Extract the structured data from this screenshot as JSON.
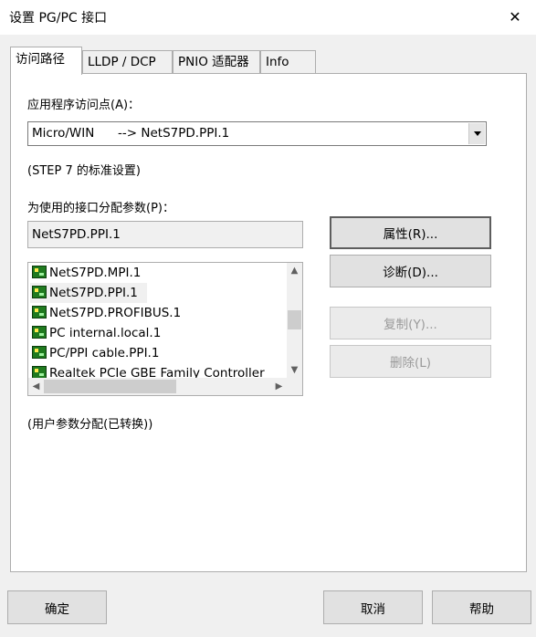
{
  "window": {
    "title": "设置 PG/PC 接口",
    "close_glyph": "✕"
  },
  "tabs": [
    {
      "label": "访问路径",
      "active": true
    },
    {
      "label": "LLDP / DCP",
      "active": false
    },
    {
      "label": "PNIO 适配器",
      "active": false
    },
    {
      "label": "Info",
      "active": false
    }
  ],
  "access_path": {
    "app_access_point_label": "应用程序访问点(A)：",
    "app_access_point_value": "Micro/WIN      --> NetS7PD.PPI.1",
    "standard_setting_note": "(STEP 7 的标准设置)",
    "param_assign_label": "为使用的接口分配参数(P)：",
    "param_assign_value": "NetS7PD.PPI.1",
    "interfaces": [
      {
        "label": "NetS7PD.MPI.1",
        "icon": "network-adapter-icon"
      },
      {
        "label": "NetS7PD.PPI.1",
        "icon": "network-adapter-icon",
        "selected": true
      },
      {
        "label": "NetS7PD.PROFIBUS.1",
        "icon": "network-adapter-icon"
      },
      {
        "label": "PC internal.local.1",
        "icon": "network-adapter-icon"
      },
      {
        "label": "PC/PPI cable.PPI.1",
        "icon": "network-adapter-icon"
      },
      {
        "label": "Realtek PCIe GBE Family Controller",
        "icon": "network-adapter-icon"
      }
    ],
    "user_param_note": "(用户参数分配(已转换))",
    "buttons": {
      "properties": "属性(R)...",
      "diagnostics": "诊断(D)...",
      "copy": "复制(Y)...",
      "delete": "删除(L)"
    }
  },
  "footer": {
    "ok": "确定",
    "cancel": "取消",
    "help": "帮助"
  },
  "scroll_glyphs": {
    "up": "▲",
    "down": "▼",
    "left": "◀",
    "right": "▶"
  },
  "colors": {
    "window_bg": "#f0f0f0",
    "panel_bg": "#ffffff",
    "icon_green": "#1f7a1f",
    "disabled_text": "#9a9a9a"
  }
}
